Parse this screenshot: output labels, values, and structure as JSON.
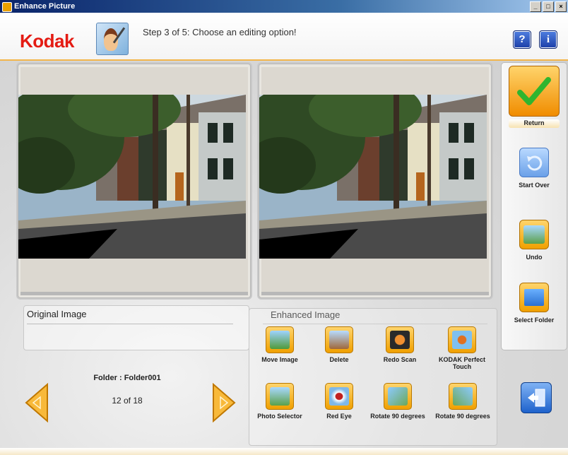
{
  "window": {
    "title": "Enhance Picture",
    "buttons": [
      "_",
      "□",
      "×"
    ]
  },
  "header": {
    "logo": "Kodak",
    "step_text": "Step 3 of 5: Choose an editing option!",
    "help_label": "?",
    "info_label": "i"
  },
  "panels": {
    "original_caption": "Original Image",
    "enhanced_caption": "Enhanced Image"
  },
  "navigation": {
    "folder_label": "Folder : Folder001",
    "counter": "12 of 18"
  },
  "tools": [
    {
      "label": "Move Image",
      "icon": "move-image-icon"
    },
    {
      "label": "Delete",
      "icon": "trash-icon"
    },
    {
      "label": "Redo Scan",
      "icon": "redo-scan-icon"
    },
    {
      "label": "KODAK Perfect Touch",
      "icon": "perfect-touch-icon"
    },
    {
      "label": "Photo Selector",
      "icon": "photo-selector-icon"
    },
    {
      "label": "Red Eye",
      "icon": "red-eye-icon"
    },
    {
      "label": "Rotate 90 degrees",
      "icon": "rotate-left-icon"
    },
    {
      "label": "Rotate 90 degrees",
      "icon": "rotate-right-icon"
    }
  ],
  "sidebar": {
    "return_label": "Return",
    "start_over_label": "Start Over",
    "undo_label": "Undo",
    "select_folder_label": "Select Folder"
  },
  "colors": {
    "brand_red": "#e41b13",
    "accent_orange": "#f0a000",
    "accent_blue": "#1e62cc"
  }
}
